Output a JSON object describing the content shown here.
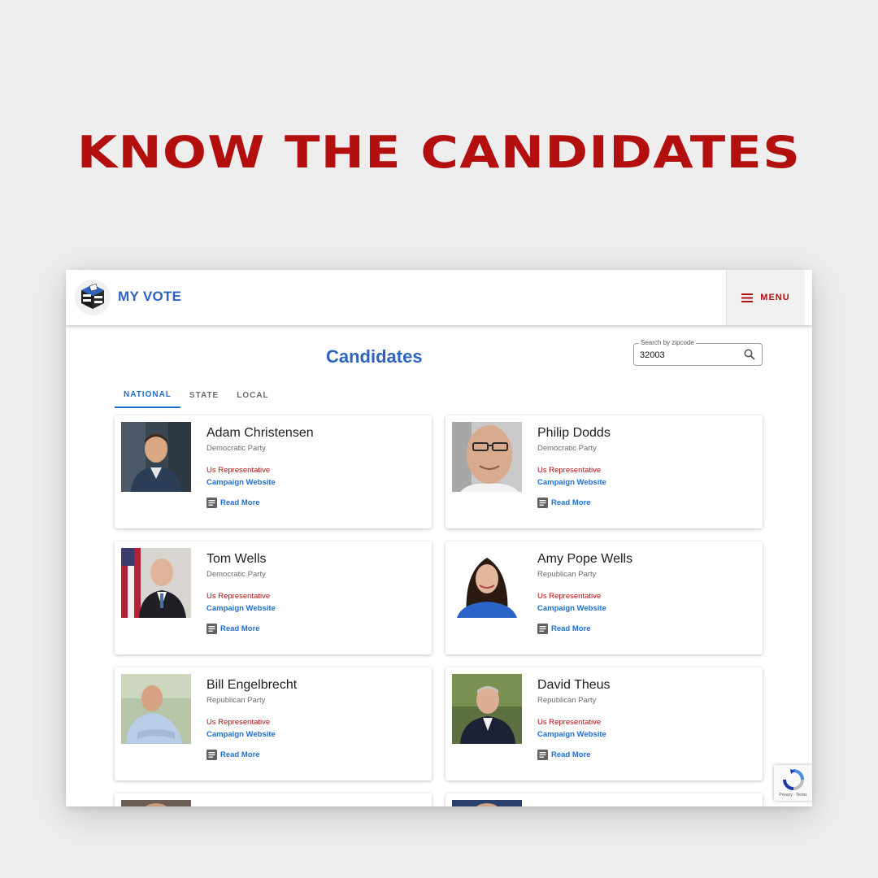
{
  "headline": "KNOW THE CANDIDATES",
  "header": {
    "brand": "MY VOTE",
    "logo_text": "MY VOTE",
    "menu_label": "MENU"
  },
  "page_title": "Candidates",
  "search": {
    "label": "Search by zipcode",
    "value": "32003"
  },
  "tabs": [
    {
      "label": "NATIONAL",
      "active": true
    },
    {
      "label": "STATE",
      "active": false
    },
    {
      "label": "LOCAL",
      "active": false
    }
  ],
  "candidates": [
    {
      "name": "Adam Christensen",
      "party": "Democratic Party",
      "office": "Us Representative",
      "website_label": "Campaign Website",
      "more_label": "Read More",
      "photo": "man-smiling-dark-background"
    },
    {
      "name": "Philip Dodds",
      "party": "Democratic Party",
      "office": "Us Representative",
      "website_label": "Campaign Website",
      "more_label": "Read More",
      "photo": "man-with-glasses-closeup"
    },
    {
      "name": "Tom Wells",
      "party": "Democratic Party",
      "office": "Us Representative",
      "website_label": "Campaign Website",
      "more_label": "Read More",
      "photo": "man-with-flag-background"
    },
    {
      "name": "Amy Pope Wells",
      "party": "Republican Party",
      "office": "Us Representative",
      "website_label": "Campaign Website",
      "more_label": "Read More",
      "photo": "woman-dark-hair-blue-top"
    },
    {
      "name": "Bill Engelbrecht",
      "party": "Republican Party",
      "office": "Us Representative",
      "website_label": "Campaign Website",
      "more_label": "Read More",
      "photo": "man-arms-crossed-outdoors"
    },
    {
      "name": "David Theus",
      "party": "Republican Party",
      "office": "Us Representative",
      "website_label": "Campaign Website",
      "more_label": "Read More",
      "photo": "man-suit-greenery"
    }
  ],
  "colors": {
    "brand_red": "#b30f0f",
    "brand_blue": "#2f63c2",
    "link_blue": "#1f6fd1"
  },
  "recaptcha": {
    "text": "Privacy - Terms"
  }
}
